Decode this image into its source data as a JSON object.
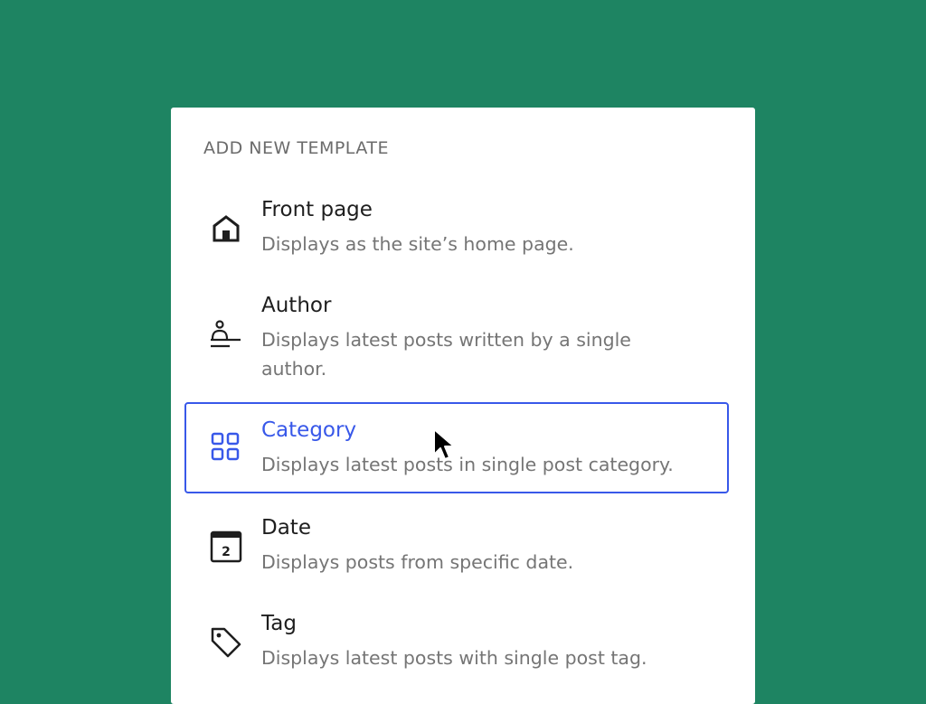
{
  "panel": {
    "heading": "ADD NEW TEMPLATE",
    "items": [
      {
        "title": "Front page",
        "description": "Displays as the site’s home page.",
        "icon": "home-icon",
        "selected": false
      },
      {
        "title": "Author",
        "description": "Displays latest posts written by a single author.",
        "icon": "author-icon",
        "selected": false
      },
      {
        "title": "Category",
        "description": "Displays latest posts in single post category.",
        "icon": "category-icon",
        "selected": true
      },
      {
        "title": "Date",
        "description": "Displays posts from specific date.",
        "icon": "calendar-icon",
        "icon_text": "2",
        "selected": false
      },
      {
        "title": "Tag",
        "description": "Displays latest posts with single post tag.",
        "icon": "tag-icon",
        "selected": false
      }
    ]
  },
  "colors": {
    "background": "#1e8462",
    "accent": "#3858e9",
    "text": "#1e1e1e",
    "muted": "#757575"
  }
}
